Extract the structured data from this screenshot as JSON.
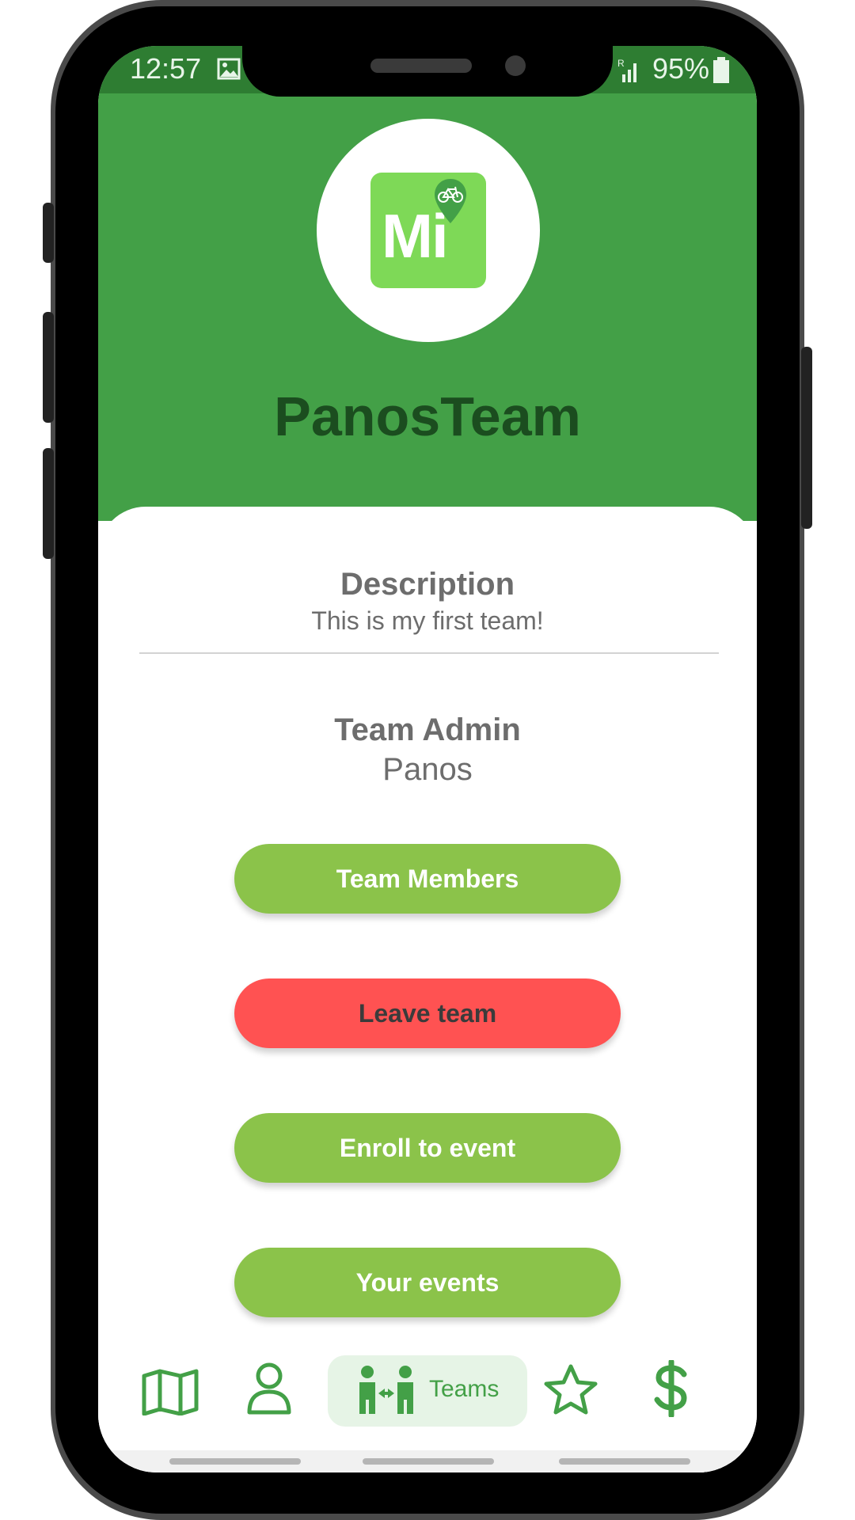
{
  "status_bar": {
    "time": "12:57",
    "battery": "95%"
  },
  "team": {
    "name": "PanosTeam",
    "logo_text": "Mi",
    "description_label": "Description",
    "description": "This is my first team!",
    "admin_label": "Team Admin",
    "admin": "Panos"
  },
  "buttons": {
    "team_members": "Team Members",
    "leave_team": "Leave team",
    "enroll_event": "Enroll to event",
    "your_events": "Your events"
  },
  "bottom_nav": {
    "items": [
      {
        "icon": "map-icon"
      },
      {
        "icon": "user-icon"
      },
      {
        "icon": "teams-icon",
        "label": "Teams",
        "active": true
      },
      {
        "icon": "star-icon"
      },
      {
        "icon": "dollar-icon"
      }
    ]
  },
  "colors": {
    "primary": "#43a047",
    "accent_green": "#8bc34a",
    "danger": "#ff5252",
    "dark_green": "#1b4d1f"
  }
}
